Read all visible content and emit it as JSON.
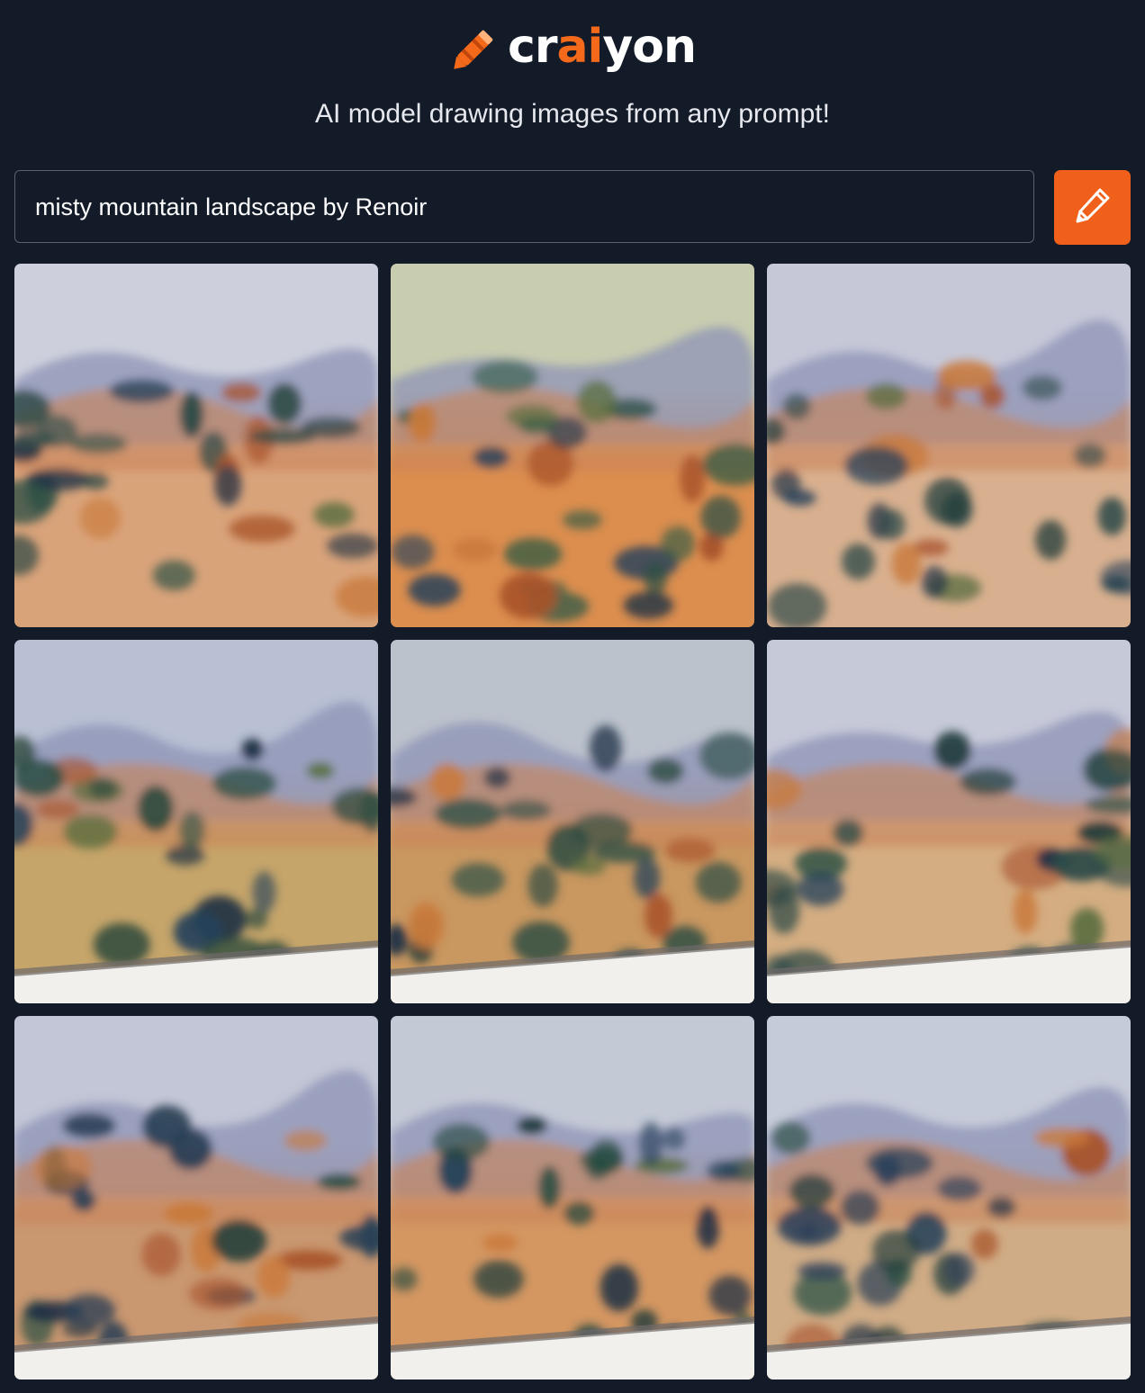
{
  "brand": {
    "name_parts": [
      "cr",
      "ai",
      "yon"
    ],
    "accent_color": "#f46a1a"
  },
  "tagline": "AI model drawing images from any prompt!",
  "prompt": {
    "value": "misty mountain landscape by Renoir",
    "placeholder": ""
  },
  "draw_button": {
    "icon": "pencil-icon",
    "color": "#f0601a"
  },
  "results": {
    "count": 9,
    "tiles": [
      {
        "name": "generated-image-1",
        "sky": "#cdd0dc",
        "ground": "#d9a37a",
        "tint": "#2d4a46"
      },
      {
        "name": "generated-image-2",
        "sky": "#c9cdb0",
        "ground": "#dc8e4f",
        "tint": "#2f5a45"
      },
      {
        "name": "generated-image-3",
        "sky": "#c6c8d8",
        "ground": "#d9b08f",
        "tint": "#2a4848"
      },
      {
        "name": "generated-image-4",
        "sky": "#b9c0d4",
        "ground": "#c6a56a",
        "tint": "#2e4a3e"
      },
      {
        "name": "generated-image-5",
        "sky": "#bcc2cc",
        "ground": "#c99760",
        "tint": "#2e4d44"
      },
      {
        "name": "generated-image-6",
        "sky": "#c6c9d8",
        "ground": "#d4ad82",
        "tint": "#2c4a48"
      },
      {
        "name": "generated-image-7",
        "sky": "#c2c6d6",
        "ground": "#c99770",
        "tint": "#2a3f55"
      },
      {
        "name": "generated-image-8",
        "sky": "#c4c9d6",
        "ground": "#d49762",
        "tint": "#244a40"
      },
      {
        "name": "generated-image-9",
        "sky": "#c6cbd9",
        "ground": "#d0ac86",
        "tint": "#2a3f58"
      }
    ]
  }
}
